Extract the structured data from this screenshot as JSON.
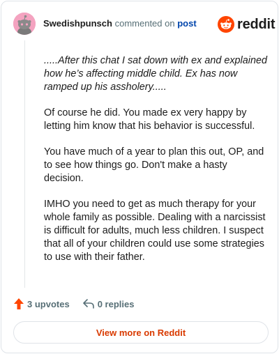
{
  "header": {
    "username": "Swedishpunsch",
    "commented_text": "commented on",
    "post_link": "post",
    "logo_text": "reddit"
  },
  "comment": {
    "paragraphs": [
      {
        "style": "italic",
        "text": ".....After this chat I sat down with ex and explained how he’s affecting middle child. Ex has now ramped up his assholery....."
      },
      {
        "style": "normal",
        "text": "Of course he did. You made ex very happy by letting him know that his behavior is successful."
      },
      {
        "style": "normal",
        "text": "You have much of a year to plan this out, OP, and to see how things go. Don't make a hasty decision."
      },
      {
        "style": "normal",
        "text": "IMHO you need to get as much therapy for your whole family as possible. Dealing with a narcissist is difficult for adults, much less children. I suspect that all of your children could use some strategies to use with their father."
      }
    ]
  },
  "actions": {
    "upvotes": "3 upvotes",
    "replies": "0 replies",
    "upvote_icon": "upvote-arrow-icon",
    "reply_icon": "reply-arrow-icon"
  },
  "footer": {
    "view_more": "View more on Reddit"
  },
  "colors": {
    "brand": "#ff4500",
    "link": "#0045ac",
    "view_more": "#d93a00"
  }
}
